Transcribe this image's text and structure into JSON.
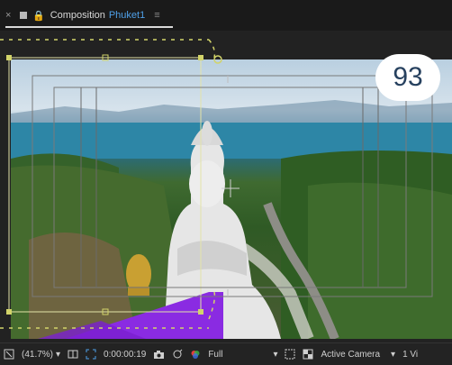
{
  "tab": {
    "close_glyph": "×",
    "lock_glyph": "🔒",
    "label": "Composition",
    "comp_name": "Phuket1",
    "menu_glyph": "≡"
  },
  "badge": {
    "number": "93"
  },
  "statusbar": {
    "zoom": "(41.7%)",
    "timecode": "0:00:00:19",
    "resolution": "Full",
    "view": "Active Camera",
    "views_count": "1 Vi"
  },
  "colors": {
    "accent": "#4fa0e8",
    "handle": "#d2d46a",
    "purple": "#8a2be2"
  }
}
